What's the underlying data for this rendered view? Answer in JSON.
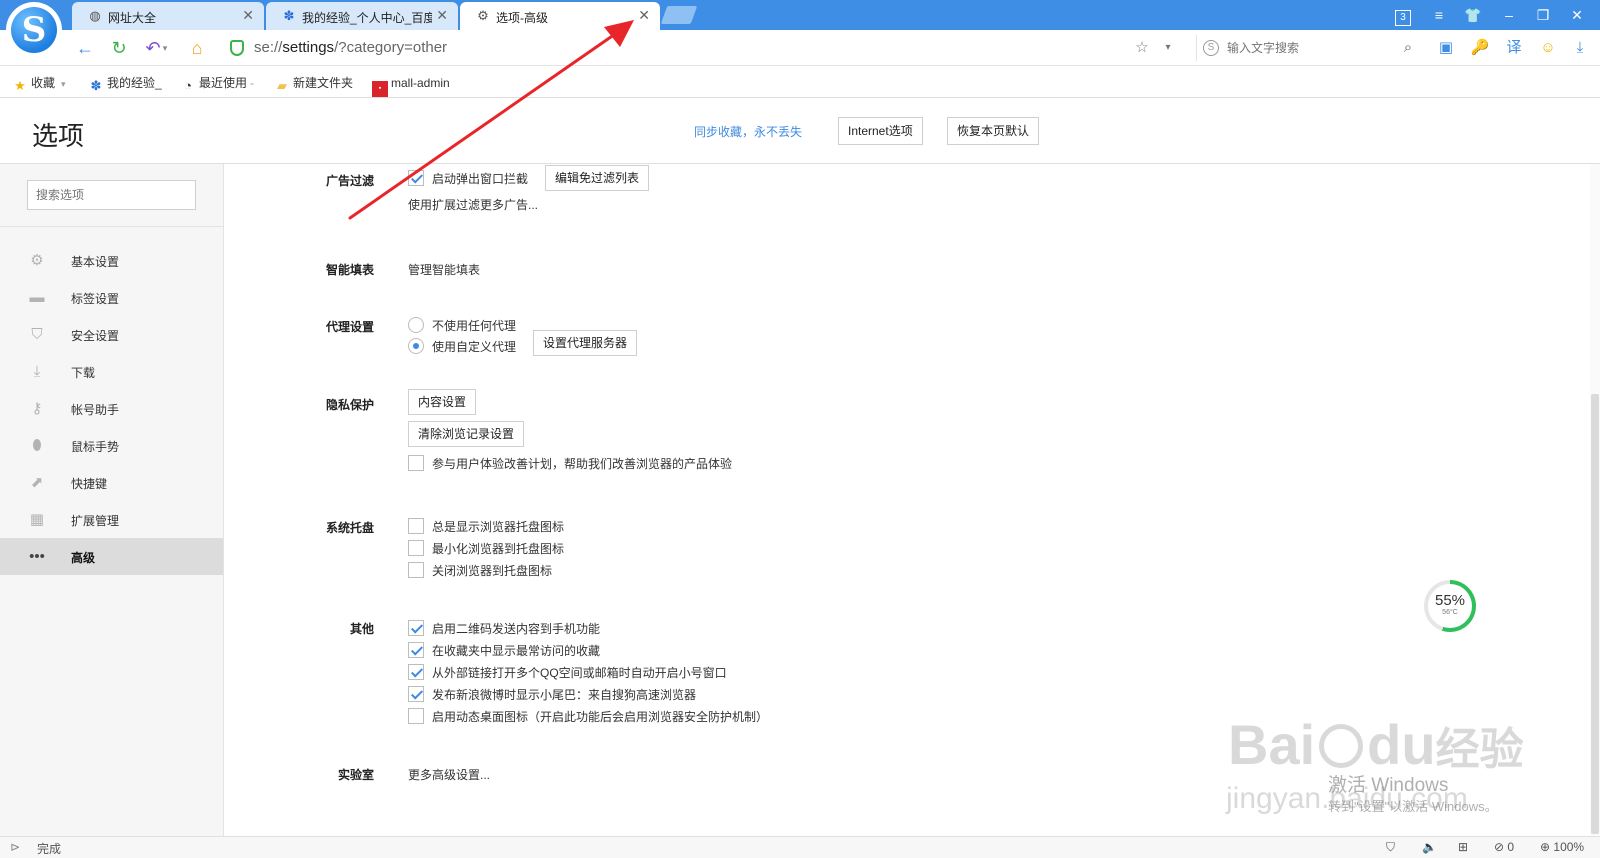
{
  "tabs": [
    {
      "label": "网址大全",
      "icon": "globe-icon"
    },
    {
      "label": "我的经验_个人中心_百度",
      "icon": "baidu-paw-icon"
    },
    {
      "label": "选项-高级",
      "icon": "gear-icon",
      "active": true
    }
  ],
  "window_controls": {
    "tab_count": "3"
  },
  "toolbar": {
    "url_prefix": "se://",
    "url_bold": "settings",
    "url_rest": "/?category=other",
    "search_placeholder": "输入文字搜索"
  },
  "bookmarks": [
    {
      "label": "收藏",
      "icon": "star-icon"
    },
    {
      "label": "我的经验_",
      "icon": "baidu-paw-icon"
    },
    {
      "label": "最近使用",
      "icon": "clock-icon"
    },
    {
      "label": "新建文件夹",
      "icon": "folder-icon"
    },
    {
      "label": "mall-admin",
      "icon": "site-icon"
    }
  ],
  "header": {
    "title": "选项",
    "sync_link": "同步收藏，永不丢失",
    "internet_btn": "Internet选项",
    "restore_btn": "恢复本页默认"
  },
  "sidebar": {
    "search_placeholder": "搜索选项",
    "items": [
      {
        "label": "基本设置",
        "icon": "gear-icon"
      },
      {
        "label": "标签设置",
        "icon": "tab-icon"
      },
      {
        "label": "安全设置",
        "icon": "shield-icon"
      },
      {
        "label": "下载",
        "icon": "download-icon"
      },
      {
        "label": "帐号助手",
        "icon": "key-icon"
      },
      {
        "label": "鼠标手势",
        "icon": "mouse-icon"
      },
      {
        "label": "快捷键",
        "icon": "shortcut-icon"
      },
      {
        "label": "扩展管理",
        "icon": "grid-icon"
      },
      {
        "label": "高级",
        "icon": "more-icon",
        "active": true
      }
    ]
  },
  "sections": {
    "adblock": {
      "title": "广告过滤",
      "popup_block": {
        "label": "启动弹出窗口拦截",
        "checked": true
      },
      "edit_btn": "编辑免过滤列表",
      "more": "使用扩展过滤更多广告..."
    },
    "autofill": {
      "title": "智能填表",
      "manage": "管理智能填表"
    },
    "proxy": {
      "title": "代理设置",
      "no_proxy": {
        "label": "不使用任何代理",
        "checked": false
      },
      "custom_proxy": {
        "label": "使用自定义代理",
        "checked": true
      },
      "server_btn": "设置代理服务器"
    },
    "privacy": {
      "title": "隐私保护",
      "content_btn": "内容设置",
      "clear_btn": "清除浏览记录设置",
      "ux_plan": {
        "label": "参与用户体验改善计划，帮助我们改善浏览器的产品体验",
        "checked": false
      }
    },
    "tray": {
      "title": "系统托盘",
      "items": [
        {
          "label": "总是显示浏览器托盘图标",
          "checked": false
        },
        {
          "label": "最小化浏览器到托盘图标",
          "checked": false
        },
        {
          "label": "关闭浏览器到托盘图标",
          "checked": false
        }
      ]
    },
    "other": {
      "title": "其他",
      "items": [
        {
          "label": "启用二维码发送内容到手机功能",
          "checked": true
        },
        {
          "label": "在收藏夹中显示最常访问的收藏",
          "checked": true
        },
        {
          "label": "从外部链接打开多个QQ空间或邮箱时自动开启小号窗口",
          "checked": true
        },
        {
          "label": "发布新浪微博时显示小尾巴：来自搜狗高速浏览器",
          "checked": true
        },
        {
          "label": "启用动态桌面图标（开启此功能后会启用浏览器安全防护机制）",
          "checked": false
        }
      ]
    },
    "lab": {
      "title": "实验室",
      "more": "更多高级设置..."
    }
  },
  "cpu_widget": {
    "percent": "55%",
    "temp": "56°C",
    "value": 0.55
  },
  "watermark": {
    "brand": "Bai",
    "du": "du",
    "jingyan": "经验",
    "site": "jingyan.baidu.com",
    "activate": "激活 Windows",
    "activate_sub": "转到\"设置\"以激活 Windows。"
  },
  "status": {
    "text": "完成",
    "blocked_count": "0",
    "zoom": "100%"
  },
  "colors": {
    "titlebar": "#3e8ee6",
    "accent": "#3c8ae3",
    "link": "#3f8be0",
    "annotation": "#e8262a"
  }
}
